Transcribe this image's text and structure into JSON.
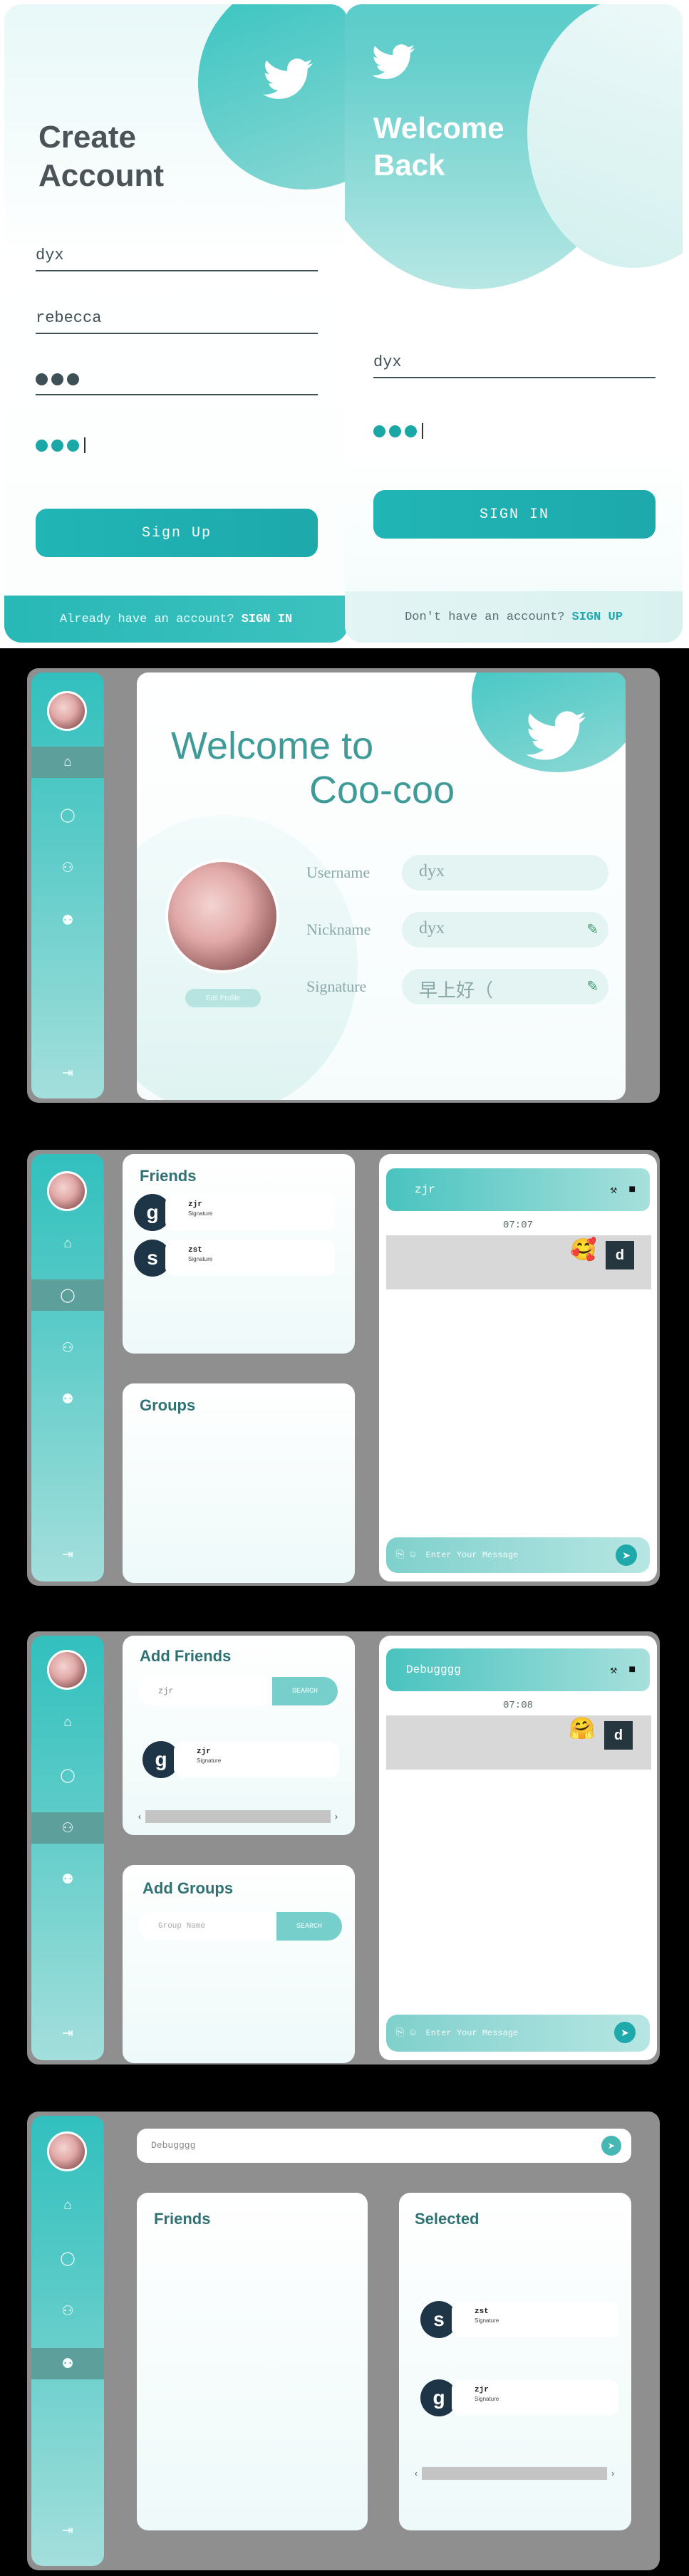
{
  "signup": {
    "title_line1": "Create",
    "title_line2": "Account",
    "username": "dyx",
    "nickname": "rebecca",
    "button": "Sign Up",
    "footer_text": "Already have an account?",
    "footer_link": "SIGN IN",
    "icon": "twitter-bird-icon"
  },
  "signin": {
    "title_line1": "Welcome",
    "title_line2": "Back",
    "username": "dyx",
    "button": "SIGN IN",
    "footer_text": "Don't have an account?",
    "footer_link": "SIGN UP",
    "icon": "twitter-bird-icon"
  },
  "sidebar": {
    "icons": [
      "home-icon",
      "chat-icon",
      "add-friend-icon",
      "group-icon",
      "logout-icon"
    ]
  },
  "profile": {
    "welcome_line1": "Welcome to",
    "welcome_line2": "Coo-coo",
    "edit_profile": "Edit Profile",
    "username_label": "Username",
    "username_value": "dyx",
    "nickname_label": "Nickname",
    "nickname_value": "dyx",
    "signature_label": "Signature",
    "signature_value": "早上好（"
  },
  "chat_screen": {
    "friends_title": "Friends",
    "groups_title": "Groups",
    "friends": [
      {
        "initial": "g",
        "name": "zjr",
        "signature": "Signature"
      },
      {
        "initial": "s",
        "name": "zst",
        "signature": "Signature"
      }
    ],
    "chat_title": "zjr",
    "time": "07:07",
    "sender_initial": "d",
    "input_placeholder": "Enter Your Message"
  },
  "add_screen": {
    "add_friends_title": "Add Friends",
    "friend_search_value": "zjr",
    "search_button": "SEARCH",
    "result": {
      "initial": "g",
      "name": "zjr",
      "signature": "Signature"
    },
    "add_groups_title": "Add Groups",
    "group_search_placeholder": "Group Name",
    "chat_title": "Debugggg",
    "time": "07:08",
    "sender_initial": "d",
    "input_placeholder": "Enter Your Message"
  },
  "group_screen": {
    "group_name": "Debugggg",
    "friends_title": "Friends",
    "selected_title": "Selected",
    "selected": [
      {
        "initial": "s",
        "name": "zst",
        "signature": "Signature"
      },
      {
        "initial": "g",
        "name": "zjr",
        "signature": "Signature"
      }
    ]
  },
  "colors": {
    "accent": "#1fa9ab",
    "sidebar_top": "#31c0be",
    "frame": "#8f8f8f"
  }
}
